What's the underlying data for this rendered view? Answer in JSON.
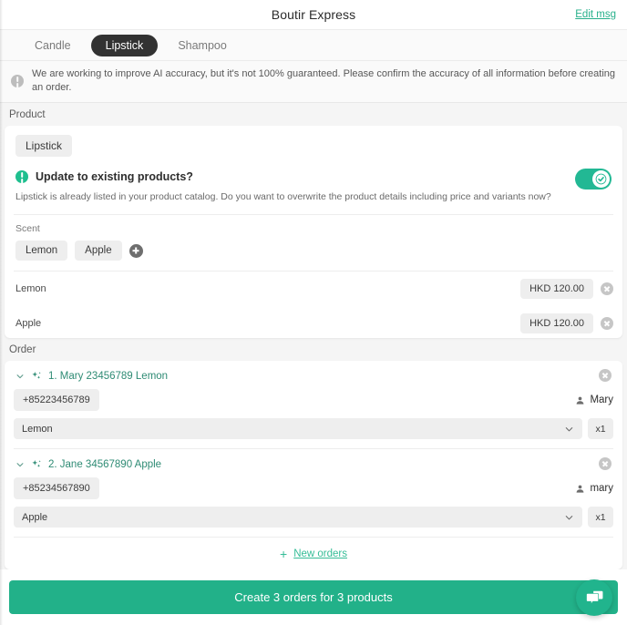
{
  "header": {
    "title": "Boutir Express",
    "edit_msg": "Edit msg"
  },
  "tabs": [
    {
      "label": "Candle",
      "active": false
    },
    {
      "label": "Lipstick",
      "active": true
    },
    {
      "label": "Shampoo",
      "active": false
    }
  ],
  "notice": {
    "icon": "info-circle-icon",
    "text": "We are working to improve AI accuracy, but it's not 100% guaranteed. Please confirm the accuracy of all information before creating an order."
  },
  "product": {
    "section_label": "Product",
    "name_chip": "Lipstick",
    "update": {
      "title": "Update to existing products?",
      "description": "Lipstick is already listed in your product catalog. Do you want to overwrite the product details including price and variants now?",
      "toggle_on": true,
      "toggle_color": "#22b894"
    },
    "variant_group_label": "Scent",
    "variant_chips": [
      "Lemon",
      "Apple"
    ],
    "add_variant_icon": "plus-circle-icon",
    "variant_prices": [
      {
        "name": "Lemon",
        "price": "HKD 120.00"
      },
      {
        "name": "Apple",
        "price": "HKD 120.00"
      }
    ]
  },
  "order": {
    "section_label": "Order",
    "items": [
      {
        "title": "1. Mary 23456789 Lemon",
        "phone": "+85223456789",
        "customer": "Mary",
        "variant": "Lemon",
        "qty": "x1"
      },
      {
        "title": "2. Jane 34567890 Apple",
        "phone": "+85234567890",
        "customer": "mary",
        "variant": "Apple",
        "qty": "x1"
      }
    ],
    "new_orders_label": "New orders",
    "new_orders_plus": "+"
  },
  "cta": {
    "label": "Create 3 orders for 3 products",
    "color": "#22b189"
  },
  "fab": {
    "icon": "chat-bubbles-icon",
    "color": "#21b48d"
  }
}
